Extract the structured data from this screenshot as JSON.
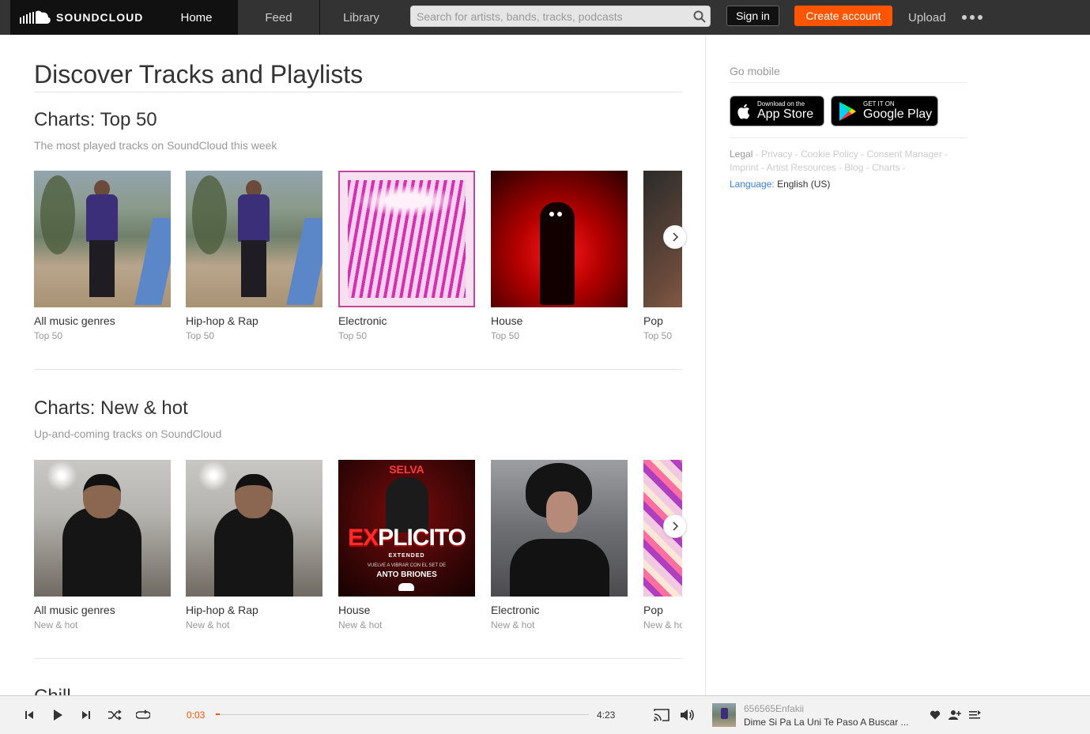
{
  "header": {
    "logo_text": "SOUNDCLOUD",
    "nav": [
      {
        "label": "Home",
        "active": true
      },
      {
        "label": "Feed",
        "active": false
      },
      {
        "label": "Library",
        "active": false
      }
    ],
    "search_placeholder": "Search for artists, bands, tracks, podcasts",
    "signin_label": "Sign in",
    "create_account_label": "Create account",
    "upload_label": "Upload",
    "accent_color": "#ff5500"
  },
  "main": {
    "page_title": "Discover Tracks and Playlists",
    "sections": [
      {
        "title": "Charts: Top 50",
        "subtitle": "The most played tracks on SoundCloud this week",
        "tiles": [
          {
            "title": "All music genres",
            "sub": "Top 50"
          },
          {
            "title": "Hip-hop & Rap",
            "sub": "Top 50"
          },
          {
            "title": "Electronic",
            "sub": "Top 50"
          },
          {
            "title": "House",
            "sub": "Top 50"
          },
          {
            "title": "Pop",
            "sub": "Top 50"
          }
        ]
      },
      {
        "title": "Charts: New & hot",
        "subtitle": "Up-and-coming tracks on SoundCloud",
        "tiles": [
          {
            "title": "All music genres",
            "sub": "New & hot"
          },
          {
            "title": "Hip-hop & Rap",
            "sub": "New & hot"
          },
          {
            "title": "House",
            "sub": "New & hot"
          },
          {
            "title": "Electronic",
            "sub": "New & hot"
          },
          {
            "title": "Pop",
            "sub": "New & hot"
          }
        ]
      },
      {
        "title": "Chill"
      }
    ],
    "artwork_text": {
      "selva": "SELVA",
      "explicito_a": "EX",
      "explicito_b": "PLICITO",
      "extended": "EXTENDED",
      "line1": "VUELVE A VIBRAR CON EL SET DE",
      "line2": "ANTO BRIONES"
    }
  },
  "sidebar": {
    "go_mobile": "Go mobile",
    "app_store": {
      "small": "Download on the",
      "big": "App Store"
    },
    "google_play": {
      "small": "GET IT ON",
      "big": "Google Play"
    },
    "footer_links": [
      "Legal",
      "Privacy",
      "Cookie Policy",
      "Consent Manager",
      "Imprint",
      "Artist Resources",
      "Blog",
      "Charts"
    ],
    "language_label": "Language:",
    "language_value": "English (US)"
  },
  "player": {
    "current_time": "0:03",
    "duration": "4:23",
    "progress_fraction": 0.01,
    "artist": "656565Enfakii",
    "track_title": "Dime Si Pa La Uni Te Paso A Buscar ..."
  }
}
